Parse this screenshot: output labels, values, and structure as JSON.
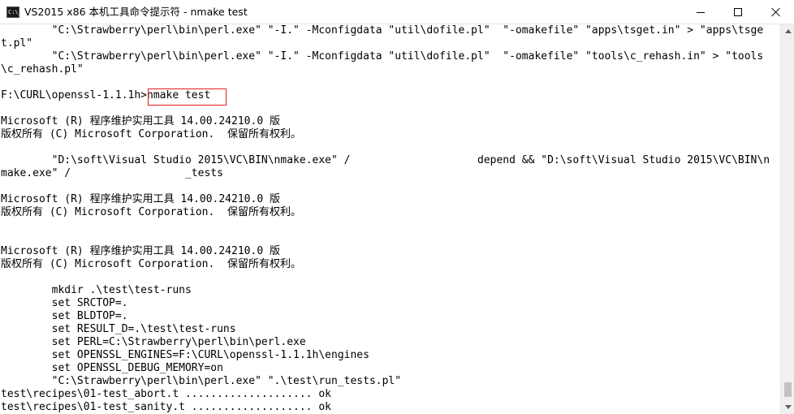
{
  "window": {
    "title": "VS2015 x86 本机工具命令提示符 - nmake  test",
    "icon_label": "C:\\_",
    "icon": "console-icon"
  },
  "console": {
    "lines": [
      "        \"C:\\Strawberry\\perl\\bin\\perl.exe\" \"-I.\" -Mconfigdata \"util\\dofile.pl\"  \"-omakefile\" \"apps\\tsget.in\" > \"apps\\tsge",
      "t.pl\"",
      "        \"C:\\Strawberry\\perl\\bin\\perl.exe\" \"-I.\" -Mconfigdata \"util\\dofile.pl\"  \"-omakefile\" \"tools\\c_rehash.in\" > \"tools",
      "\\c_rehash.pl\"",
      "",
      "F:\\CURL\\openssl-1.1.1h>nmake test",
      "",
      "Microsoft (R) 程序维护实用工具 14.00.24210.0 版",
      "版权所有 (C) Microsoft Corporation.  保留所有权利。",
      "",
      "        \"D:\\soft\\Visual Studio 2015\\VC\\BIN\\nmake.exe\" /                    depend && \"D:\\soft\\Visual Studio 2015\\VC\\BIN\\n",
      "make.exe\" /                  _tests",
      "",
      "Microsoft (R) 程序维护实用工具 14.00.24210.0 版",
      "版权所有 (C) Microsoft Corporation.  保留所有权利。",
      "",
      "",
      "Microsoft (R) 程序维护实用工具 14.00.24210.0 版",
      "版权所有 (C) Microsoft Corporation.  保留所有权利。",
      "",
      "        mkdir .\\test\\test-runs",
      "        set SRCTOP=.",
      "        set BLDTOP=.",
      "        set RESULT_D=.\\test\\test-runs",
      "        set PERL=C:\\Strawberry\\perl\\bin\\perl.exe",
      "        set OPENSSL_ENGINES=F:\\CURL\\openssl-1.1.1h\\engines",
      "        set OPENSSL_DEBUG_MEMORY=on",
      "        \"C:\\Strawberry\\perl\\bin\\perl.exe\" \".\\test\\run_tests.pl\"",
      "test\\recipes\\01-test_abort.t .................... ok",
      "test\\recipes\\01-test_sanity.t ................... ok"
    ],
    "highlighted_command": "nmake test",
    "highlight_color": "#e02020"
  },
  "colors": {
    "background": "#ffffff",
    "text": "#000000"
  }
}
